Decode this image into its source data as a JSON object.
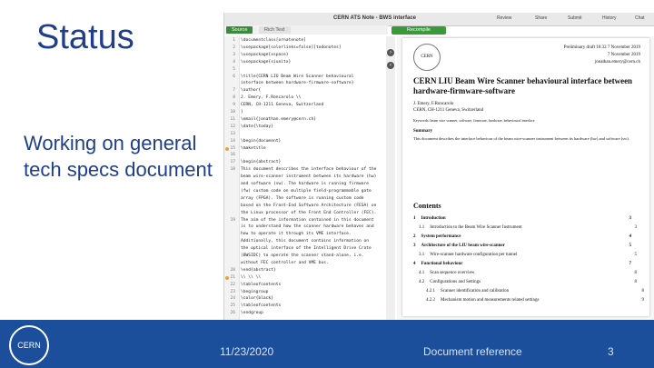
{
  "slide": {
    "title": "Status",
    "body": "Working on general tech specs document"
  },
  "app": {
    "window_title": "CERN ATS Note - BWS interface",
    "tab_source": "Source",
    "tab_rich": "Rich Text",
    "recompile": "Recompile",
    "toolbar_buttons": [
      "Review",
      "Share",
      "Submit",
      "History",
      "Chat"
    ]
  },
  "editor": {
    "lines": [
      {
        "n": "1",
        "t": "\\documentclass[ornatenote]"
      },
      {
        "n": "2",
        "t": "\\usepackage[colorlinks=false][todonotes]"
      },
      {
        "n": "3",
        "t": "\\usepackage{xspace}"
      },
      {
        "n": "4",
        "t": "\\usepackage{siunitx}"
      },
      {
        "n": "5",
        "t": ""
      },
      {
        "n": "6",
        "t": "\\title{CERN LIU Beam Wire Scanner behavioural"
      },
      {
        "n": "",
        "t": "interface between hardware-firmware-software}"
      },
      {
        "n": "7",
        "t": "\\author{"
      },
      {
        "n": "8",
        "t": "  J. Emery, F.Roncarolo \\\\"
      },
      {
        "n": "9",
        "t": "  CERN, CH-1211 Geneva, Switzerland"
      },
      {
        "n": "10",
        "t": "}"
      },
      {
        "n": "11",
        "t": "\\email{jonathan.emery@cern.ch}"
      },
      {
        "n": "12",
        "t": "\\date{\\today}"
      },
      {
        "n": "13",
        "t": ""
      },
      {
        "n": "14",
        "t": "\\begin{document}"
      },
      {
        "n": "15",
        "t": "\\maketitle"
      },
      {
        "n": "16",
        "t": ""
      },
      {
        "n": "17",
        "t": "\\begin{abstract}"
      },
      {
        "n": "18",
        "t": "This document describes the interface behaviour of the"
      },
      {
        "n": "",
        "t": "beam wire-scanner instrument between its hardware (hw)"
      },
      {
        "n": "",
        "t": "and software (sw). The hardware is running firmware"
      },
      {
        "n": "",
        "t": "(fw) custom code on multiple field-programmable gate"
      },
      {
        "n": "",
        "t": "array (FPGA). The software is running custom code"
      },
      {
        "n": "",
        "t": "based on the Front-End Software Architecture (FESA) on"
      },
      {
        "n": "",
        "t": "the Linux processor of the Front End Controller (FEC)."
      },
      {
        "n": "19",
        "t": "The aim of the information contained in this document"
      },
      {
        "n": "",
        "t": "is to understand how the scanner hardware behaves and"
      },
      {
        "n": "",
        "t": "how to operate it through its VME interface."
      },
      {
        "n": "",
        "t": "Additionally, this document contains information on"
      },
      {
        "n": "",
        "t": "the optical interface of the Intelligent Drive Crate"
      },
      {
        "n": "",
        "t": "(BWSIDC) to operate the scanner stand-alone, i.e."
      },
      {
        "n": "",
        "t": "without FEC controller and VME bus."
      },
      {
        "n": "20",
        "t": "\\end{abstract}"
      },
      {
        "n": "21",
        "t": "\\\\ \\\\ \\\\"
      },
      {
        "n": "22",
        "t": "\\tableofcontents"
      },
      {
        "n": "23",
        "t": "\\begingroup"
      },
      {
        "n": "24",
        "t": "\\color{black}"
      },
      {
        "n": "25",
        "t": "\\tableofcontents"
      },
      {
        "n": "26",
        "t": "\\endgroup"
      }
    ]
  },
  "pdf": {
    "header_right_1": "Preliminary draft 10:32 7 November 2019",
    "header_right_2": "7 November 2019",
    "header_right_3": "jonathan.emery@cern.ch",
    "title": "CERN LIU Beam Wire Scanner behavioural interface between hardware-firmware-software",
    "authors": "J. Emery, F.Roncarolo",
    "affil": "CERN, CH-1211 Geneva, Switzerland",
    "keywords": "Keywords: beam wire scanner, software, firmware, hardware, behavioural interface",
    "summary_heading": "Summary",
    "summary_text": "This document describes the interface behaviour of the beam wire-scanner instrument between its hardware (hw) and software (sw).",
    "contents_heading": "Contents",
    "toc": [
      {
        "num": "1",
        "title": "Introduction",
        "page": "3"
      },
      {
        "num": "1.1",
        "title": "Introduction to the Beam Wire Scanner Instrument",
        "page": "3"
      },
      {
        "num": "2",
        "title": "System performance",
        "page": "4"
      },
      {
        "num": "3",
        "title": "Architecture of the LIU beam wire-scanner",
        "page": "5"
      },
      {
        "num": "3.1",
        "title": "Wire-scanner hardware configuration per tunnel",
        "page": "5"
      },
      {
        "num": "4",
        "title": "Functional behaviour",
        "page": "7"
      },
      {
        "num": "4.1",
        "title": "Scan sequence overview",
        "page": "8"
      },
      {
        "num": "4.2",
        "title": "Configurations and Settings",
        "page": "8"
      },
      {
        "num": "4.2.1",
        "title": "Scanner identification and calibration",
        "page": "8"
      },
      {
        "num": "4.2.2",
        "title": "Mechanism motion and measurements related settings",
        "page": "9"
      }
    ]
  },
  "footer": {
    "logo": "CERN",
    "date": "11/23/2020",
    "ref": "Document reference",
    "page": "3"
  }
}
